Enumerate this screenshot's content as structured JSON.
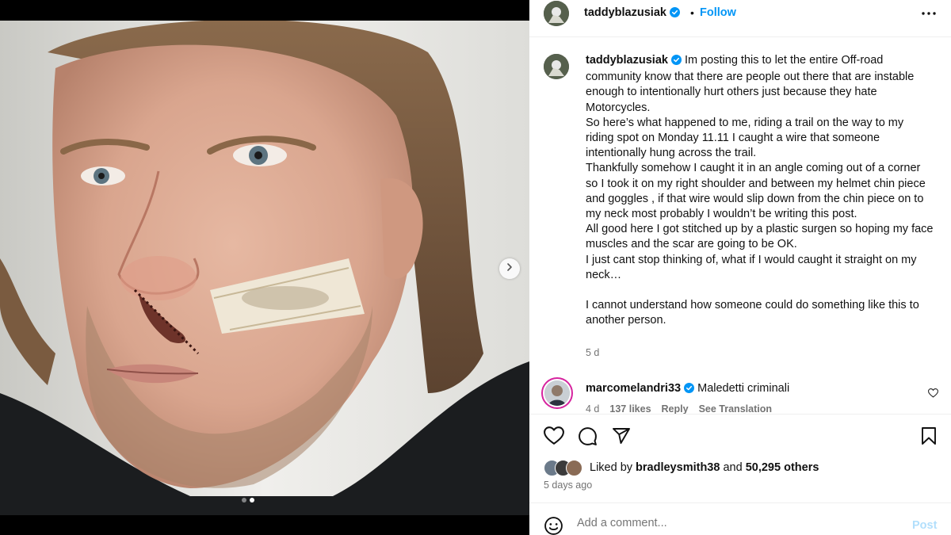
{
  "post": {
    "username": "taddyblazusiak",
    "follow_label": "Follow",
    "separator": "•",
    "caption": "Im posting this to let the entire Off-road community know that there are people out there that are instable enough to intentionally hurt others just because they hate Motorcycles.\nSo here’s what happened to me, riding a trail on the way to my riding spot on Monday 11.11 I caught a wire that someone intentionally hung across the trail.\nThankfully somehow I caught it in an angle coming out of a corner so I took it on my right shoulder and between my helmet chin piece and goggles , if that wire would slip down from the chin piece on to my neck most probably I wouldn’t be writing this post.\nAll good here I got stitched up by a plastic surgen so hoping my face muscles and the scar are going to be OK.\nI just cant stop thinking of, what if I would caught it straight on my neck…\n\nI cannot understand how someone could do something like this to another person.",
    "caption_age": "5 d",
    "carousel": {
      "current": 2,
      "total": 2
    }
  },
  "comment": {
    "username": "marcomelandri33",
    "text": "Maledetti criminali",
    "age": "4 d",
    "likes": "137 likes",
    "reply_label": "Reply",
    "translate_label": "See Translation"
  },
  "likes": {
    "prefix": "Liked by",
    "user": "bradleysmith38",
    "and": "and",
    "others": "50,295 others"
  },
  "date": "5 days ago",
  "add_comment": {
    "placeholder": "Add a comment...",
    "post_label": "Post"
  },
  "icons": {
    "verified": "verified-badge-icon",
    "more": "more-horizontal-icon",
    "like": "heart-icon",
    "comment": "comment-icon",
    "share": "send-icon",
    "save": "bookmark-icon",
    "emoji": "emoji-icon",
    "next": "chevron-right-icon"
  },
  "colors": {
    "accent": "#0095f6",
    "verified": "#0095f6",
    "post_disabled": "#b2dffc",
    "secondary_text": "#737373"
  }
}
